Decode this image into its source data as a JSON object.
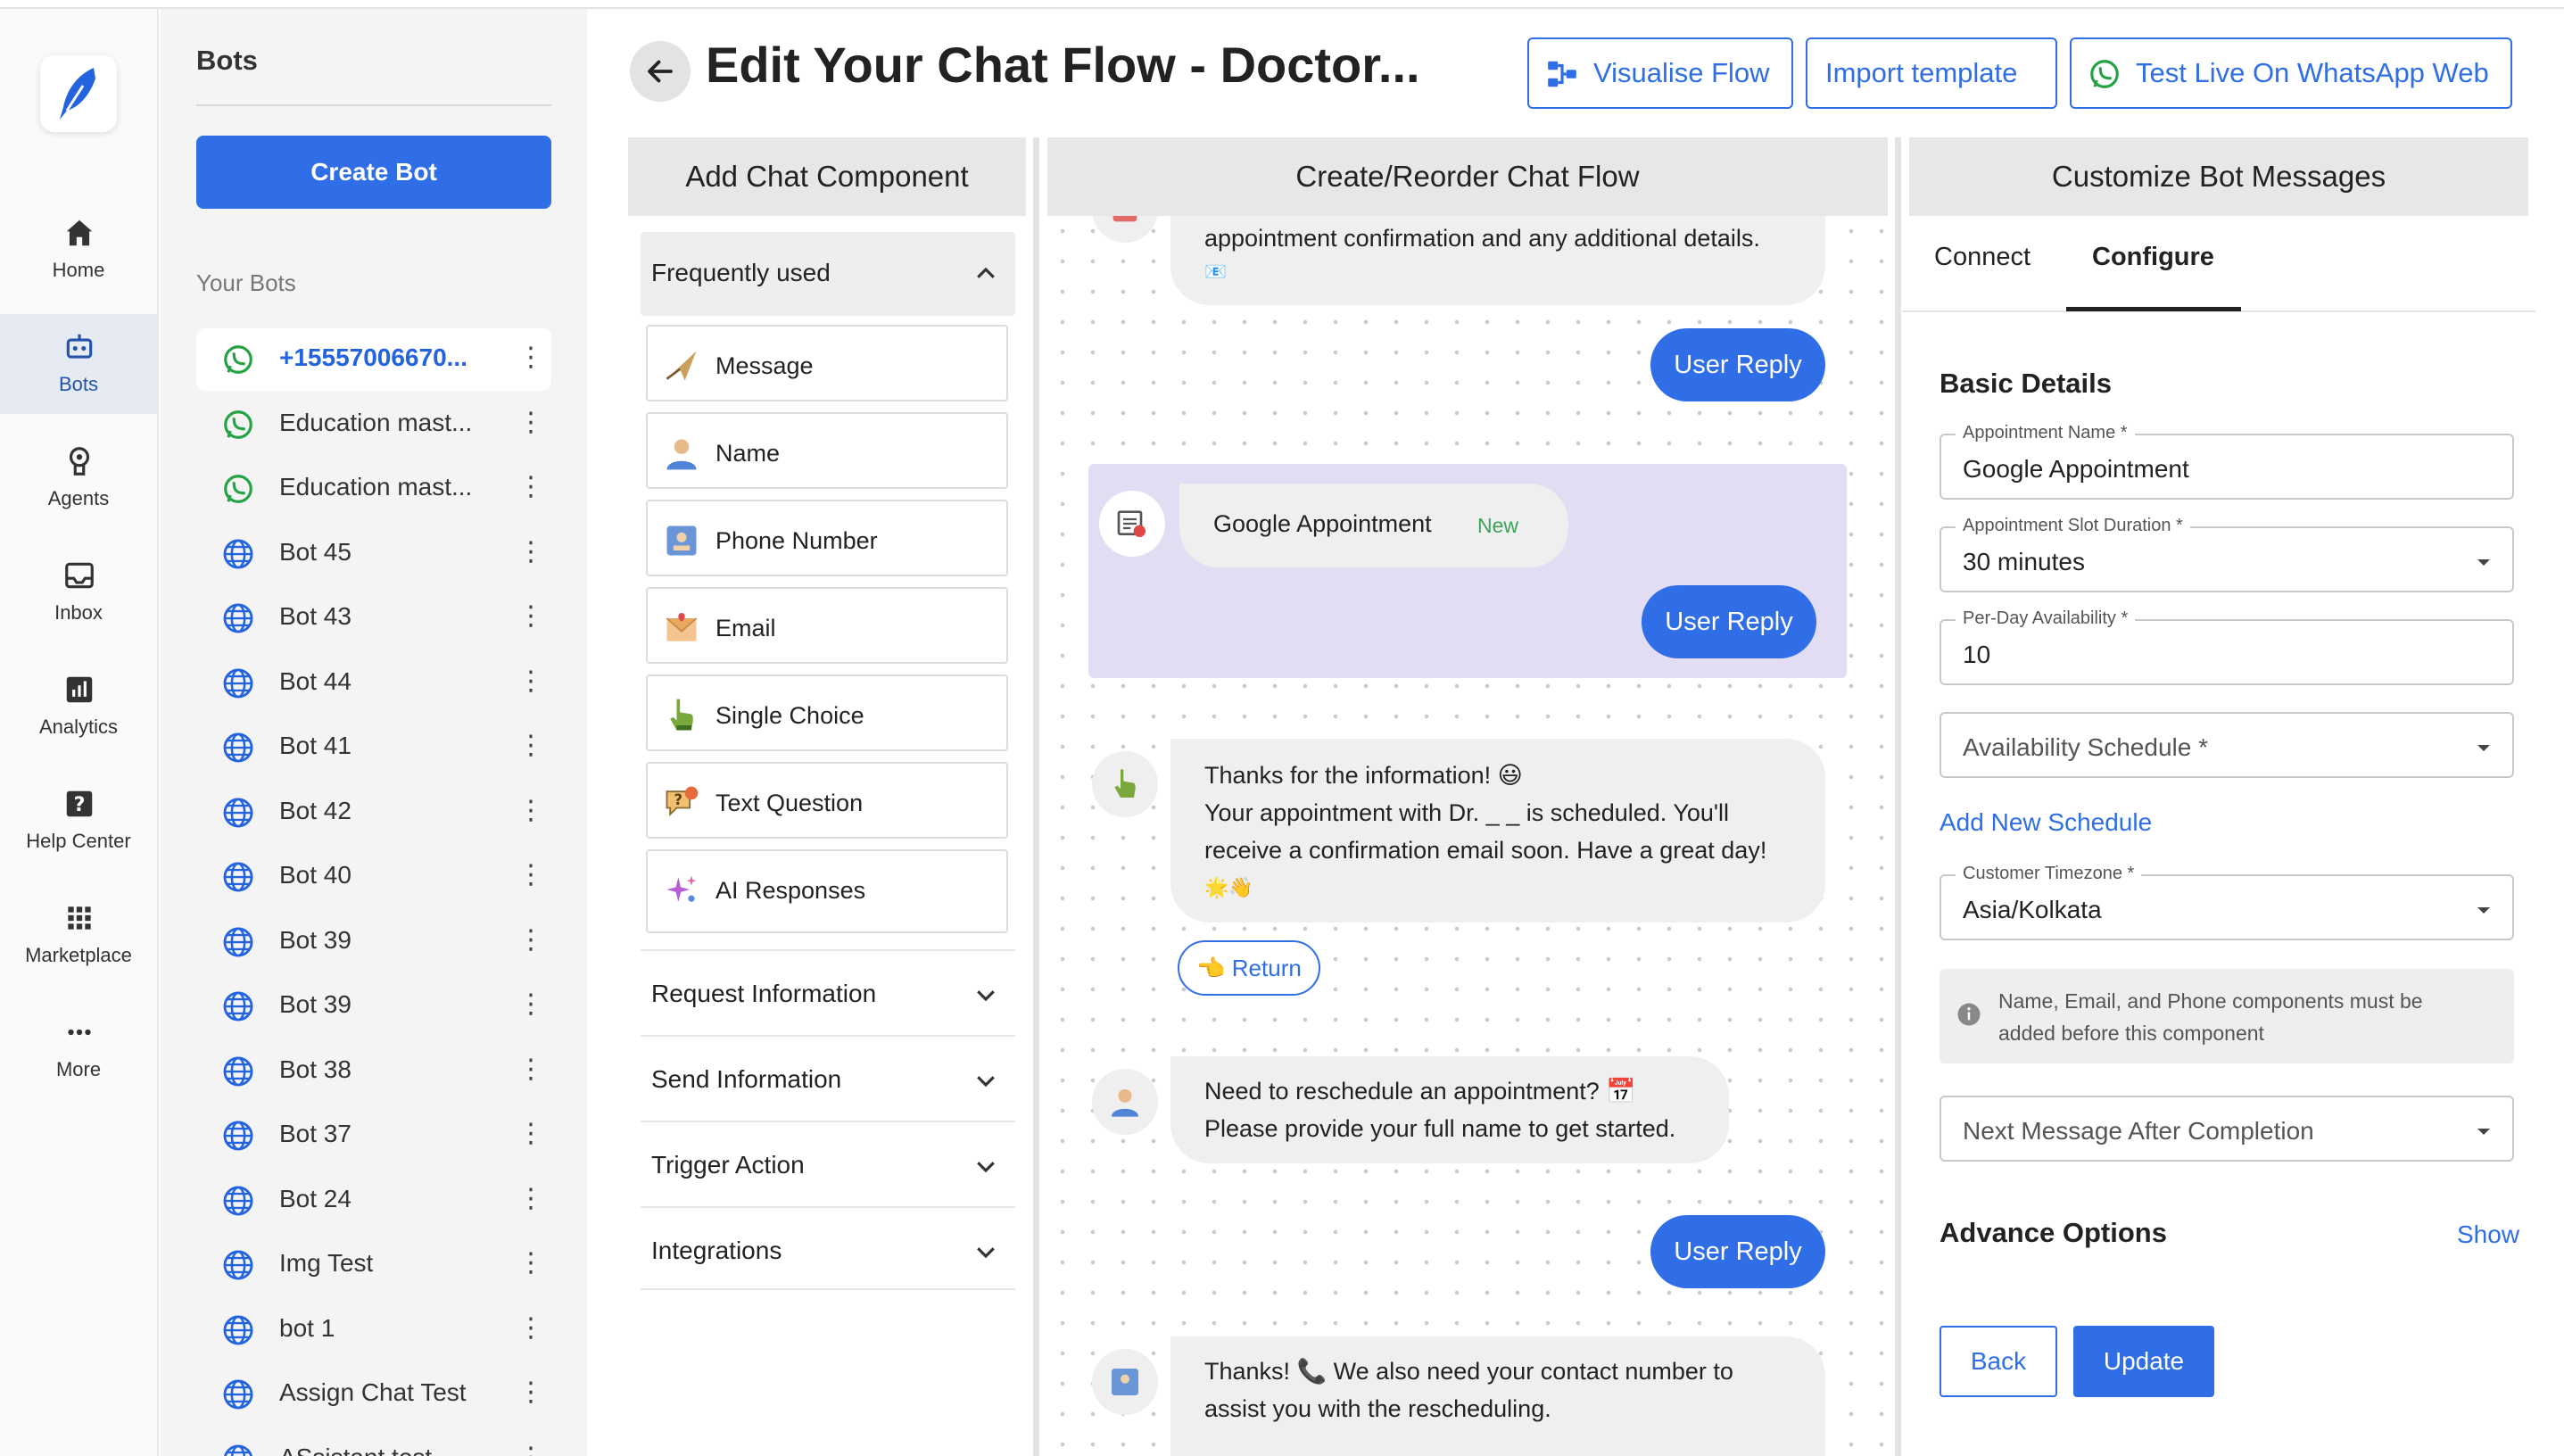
{
  "nav": {
    "items": [
      {
        "label": "Home",
        "icon": "home-icon"
      },
      {
        "label": "Bots",
        "icon": "bot-icon"
      },
      {
        "label": "Agents",
        "icon": "agent-icon"
      },
      {
        "label": "Inbox",
        "icon": "inbox-icon"
      },
      {
        "label": "Analytics",
        "icon": "analytics-icon"
      },
      {
        "label": "Help Center",
        "icon": "help-icon"
      },
      {
        "label": "Marketplace",
        "icon": "grid-icon"
      },
      {
        "label": "More",
        "icon": "more-icon"
      }
    ],
    "active": "Bots"
  },
  "bots_panel": {
    "title": "Bots",
    "create_label": "Create Bot",
    "your_bots_label": "Your Bots",
    "bots": [
      {
        "name": "+15557006670...",
        "icon": "whatsapp-icon",
        "selected": true
      },
      {
        "name": "Education mast...",
        "icon": "whatsapp-icon"
      },
      {
        "name": "Education mast...",
        "icon": "whatsapp-icon"
      },
      {
        "name": "Bot 45",
        "icon": "globe-icon"
      },
      {
        "name": "Bot 43",
        "icon": "globe-icon"
      },
      {
        "name": "Bot 44",
        "icon": "globe-icon"
      },
      {
        "name": "Bot 41",
        "icon": "globe-icon"
      },
      {
        "name": "Bot 42",
        "icon": "globe-icon"
      },
      {
        "name": "Bot 40",
        "icon": "globe-icon"
      },
      {
        "name": "Bot 39",
        "icon": "globe-icon"
      },
      {
        "name": "Bot 39",
        "icon": "globe-icon"
      },
      {
        "name": "Bot 38",
        "icon": "globe-icon"
      },
      {
        "name": "Bot 37",
        "icon": "globe-icon"
      },
      {
        "name": "Bot 24",
        "icon": "globe-icon"
      },
      {
        "name": "Img Test",
        "icon": "globe-icon"
      },
      {
        "name": "bot 1",
        "icon": "globe-icon"
      },
      {
        "name": "Assign Chat Test",
        "icon": "globe-icon"
      },
      {
        "name": "ASsistant test",
        "icon": "globe-icon"
      }
    ]
  },
  "header": {
    "title": "Edit Your Chat Flow - Doctor...",
    "visualise_label": "Visualise Flow",
    "import_label": "Import template",
    "test_label": "Test Live On WhatsApp Web"
  },
  "columns": {
    "components": "Add Chat Component",
    "flow": "Create/Reorder Chat Flow",
    "customize": "Customize Bot Messages"
  },
  "components": {
    "frequent_label": "Frequently used",
    "items": [
      {
        "label": "Message",
        "icon": "paper-plane-icon"
      },
      {
        "label": "Name",
        "icon": "user-icon"
      },
      {
        "label": "Phone Number",
        "icon": "phone-card-icon"
      },
      {
        "label": "Email",
        "icon": "envelope-icon"
      },
      {
        "label": "Single Choice",
        "icon": "pointer-hand-icon"
      },
      {
        "label": "Text Question",
        "icon": "question-bubble-icon"
      },
      {
        "label": "AI Responses",
        "icon": "sparkles-icon"
      }
    ],
    "sections": [
      "Request Information",
      "Send Information",
      "Trigger Action",
      "Integrations"
    ]
  },
  "flow": {
    "top_message": "appointment confirmation and any additional details.",
    "top_message_emoji": "📧",
    "user_reply_label": "User Reply",
    "google_appointment": "Google Appointment",
    "new_badge": "New",
    "thanks_lines": [
      "Thanks for the information! 😃",
      "Your appointment with Dr. _ _ is scheduled. You'll",
      "receive a confirmation email soon. Have a great day!",
      "🌟👋"
    ],
    "return_label": "👈 Return",
    "reschedule_lines": [
      "Need to reschedule an appointment? 📅",
      "Please provide your full name to get started."
    ],
    "contact_lines": [
      "Thanks! 📞 We also need your contact number to",
      "assist you with the rescheduling."
    ]
  },
  "right_panel": {
    "tabs": [
      "Connect",
      "Configure"
    ],
    "active_tab": "Configure",
    "basic_details": "Basic Details",
    "appointment_name": {
      "label": "Appointment Name *",
      "value": "Google Appointment"
    },
    "slot_duration": {
      "label": "Appointment Slot Duration *",
      "value": "30 minutes"
    },
    "per_day": {
      "label": "Per-Day Availability *",
      "value": "10"
    },
    "availability_schedule": "Availability Schedule *",
    "add_schedule": "Add New Schedule",
    "timezone": {
      "label": "Customer Timezone *",
      "value": "Asia/Kolkata"
    },
    "note": "Name, Email, and Phone components must be added before this component",
    "next_message": "Next Message After Completion",
    "advance_options": "Advance Options",
    "show_label": "Show",
    "back_label": "Back",
    "update_label": "Update"
  },
  "colors": {
    "accent": "#2f6ee6",
    "whatsapp": "#25a244",
    "card_highlight": "#e2ddf2"
  }
}
